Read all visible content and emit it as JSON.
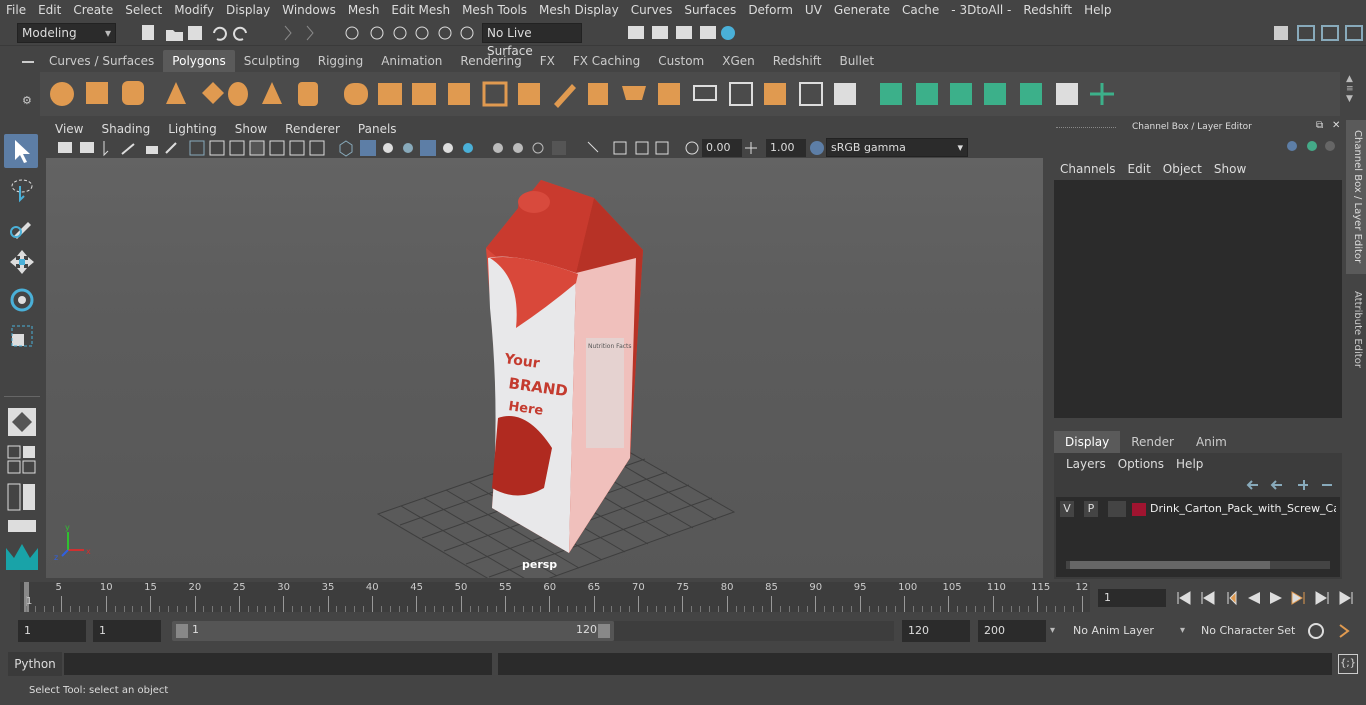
{
  "menubar": [
    "File",
    "Edit",
    "Create",
    "Select",
    "Modify",
    "Display",
    "Windows",
    "Mesh",
    "Edit Mesh",
    "Mesh Tools",
    "Mesh Display",
    "Curves",
    "Surfaces",
    "Deform",
    "UV",
    "Generate",
    "Cache",
    "- 3DtoAll -",
    "Redshift",
    "Help"
  ],
  "status": {
    "mode": "Modeling",
    "live_surface": "No Live Surface"
  },
  "shelf_tabs": [
    "Curves / Surfaces",
    "Polygons",
    "Sculpting",
    "Rigging",
    "Animation",
    "Rendering",
    "FX",
    "FX Caching",
    "Custom",
    "XGen",
    "Redshift",
    "Bullet"
  ],
  "shelf_active": "Polygons",
  "panel_menu": [
    "View",
    "Shading",
    "Lighting",
    "Show",
    "Renderer",
    "Panels"
  ],
  "panel_toolbar": {
    "exposure": "0.00",
    "gamma": "1.00",
    "colorspace": "sRGB gamma"
  },
  "viewport": {
    "camera_label": "persp",
    "brand_text": [
      "Your",
      "BRAND",
      "Here"
    ],
    "nutrition_label": "Nutrition Facts"
  },
  "channel_box": {
    "title": "Channel Box / Layer Editor",
    "menus": [
      "Channels",
      "Edit",
      "Object",
      "Show"
    ]
  },
  "layer_editor": {
    "tabs": [
      "Display",
      "Render",
      "Anim"
    ],
    "active_tab": "Display",
    "menus": [
      "Layers",
      "Options",
      "Help"
    ],
    "layer": {
      "v": "V",
      "p": "P",
      "name": "Drink_Carton_Pack_with_Screw_Cap_",
      "color": "#a01430"
    }
  },
  "side_tabs": [
    "Channel Box / Layer Editor",
    "Attribute Editor"
  ],
  "timeline": {
    "ticks": [
      "1",
      "5",
      "10",
      "15",
      "20",
      "25",
      "30",
      "35",
      "40",
      "45",
      "50",
      "55",
      "60",
      "65",
      "70",
      "75",
      "80",
      "85",
      "90",
      "95",
      "100",
      "105",
      "110",
      "115",
      "12"
    ],
    "current_frame": "1"
  },
  "range": {
    "start": "1",
    "playback_start": "1",
    "slider_start": "1",
    "slider_end": "120",
    "playback_end": "120",
    "end": "200",
    "anim_layer": "No Anim Layer",
    "char_set": "No Character Set"
  },
  "cmdline": {
    "label": "Python"
  },
  "helpline": "Select Tool: select an object",
  "colors": {
    "accent": "#5d7ea6",
    "shelf_orange": "#e09a50",
    "shelf_green": "#3cb08a"
  }
}
